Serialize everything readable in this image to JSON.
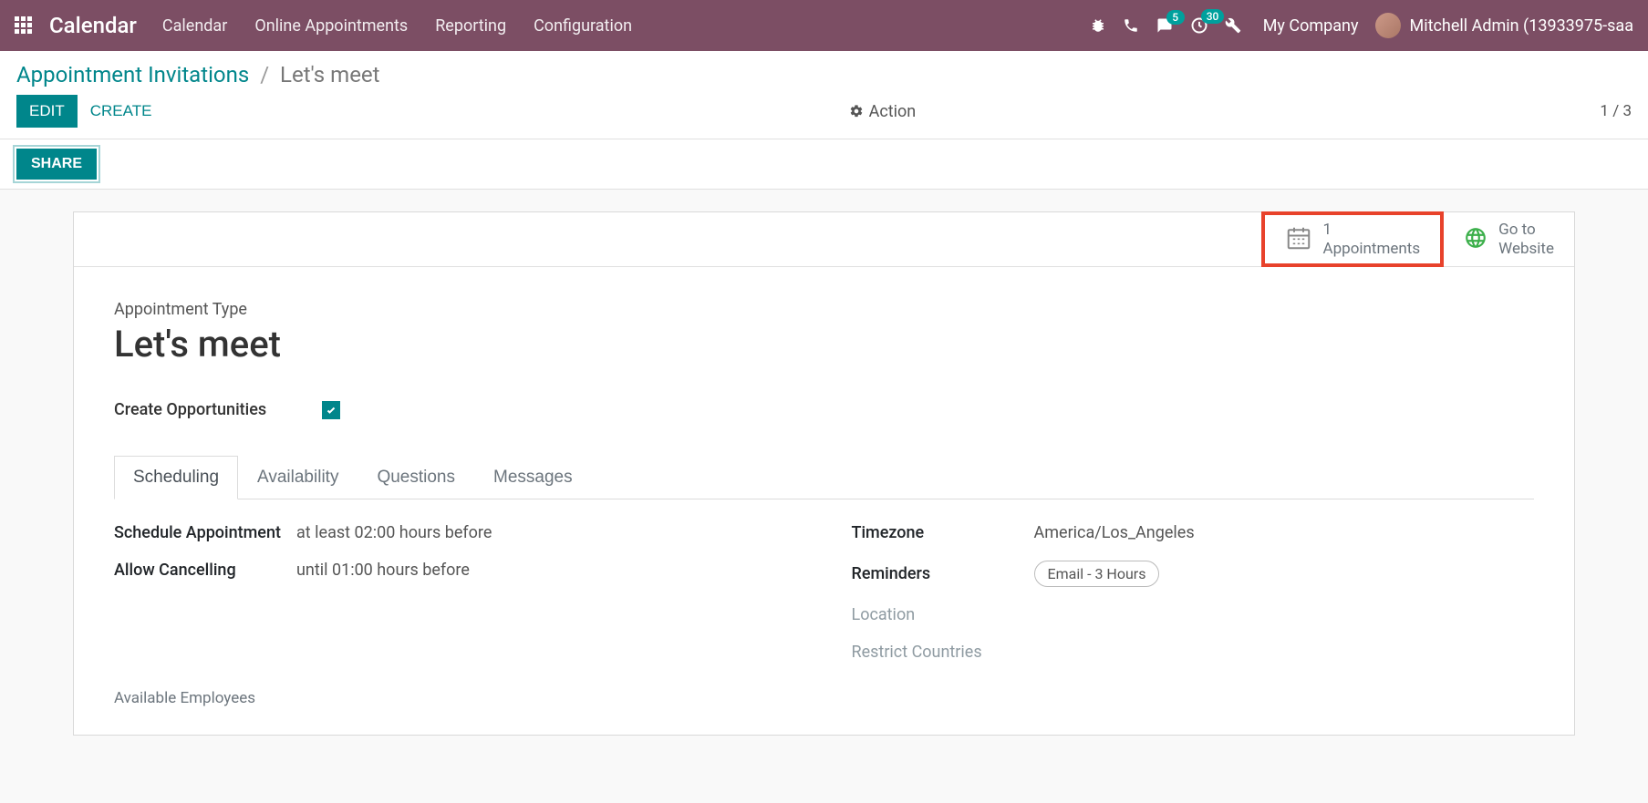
{
  "navbar": {
    "brand": "Calendar",
    "links": [
      "Calendar",
      "Online Appointments",
      "Reporting",
      "Configuration"
    ],
    "badge_messages": "5",
    "badge_activities": "30",
    "company": "My Company",
    "user": "Mitchell Admin (13933975-saa"
  },
  "breadcrumb": {
    "parent": "Appointment Invitations",
    "current": "Let's meet"
  },
  "buttons": {
    "edit": "EDIT",
    "create": "CREATE",
    "action": "Action",
    "share": "SHARE"
  },
  "pager": {
    "current": "1",
    "total": "3"
  },
  "stat": {
    "appointments_count": "1",
    "appointments_label": "Appointments",
    "website_line1": "Go to",
    "website_line2": "Website"
  },
  "record": {
    "type_label": "Appointment Type",
    "title": "Let's meet",
    "create_opp_label": "Create Opportunities"
  },
  "tabs": [
    "Scheduling",
    "Availability",
    "Questions",
    "Messages"
  ],
  "scheduling": {
    "schedule_label": "Schedule Appointment",
    "schedule_value": "at least 02:00 hours before",
    "cancel_label": "Allow Cancelling",
    "cancel_value": "until 01:00 hours before",
    "timezone_label": "Timezone",
    "timezone_value": "America/Los_Angeles",
    "reminders_label": "Reminders",
    "reminders_value": "Email - 3 Hours",
    "location_label": "Location",
    "restrict_label": "Restrict Countries",
    "employees_label": "Available Employees"
  }
}
